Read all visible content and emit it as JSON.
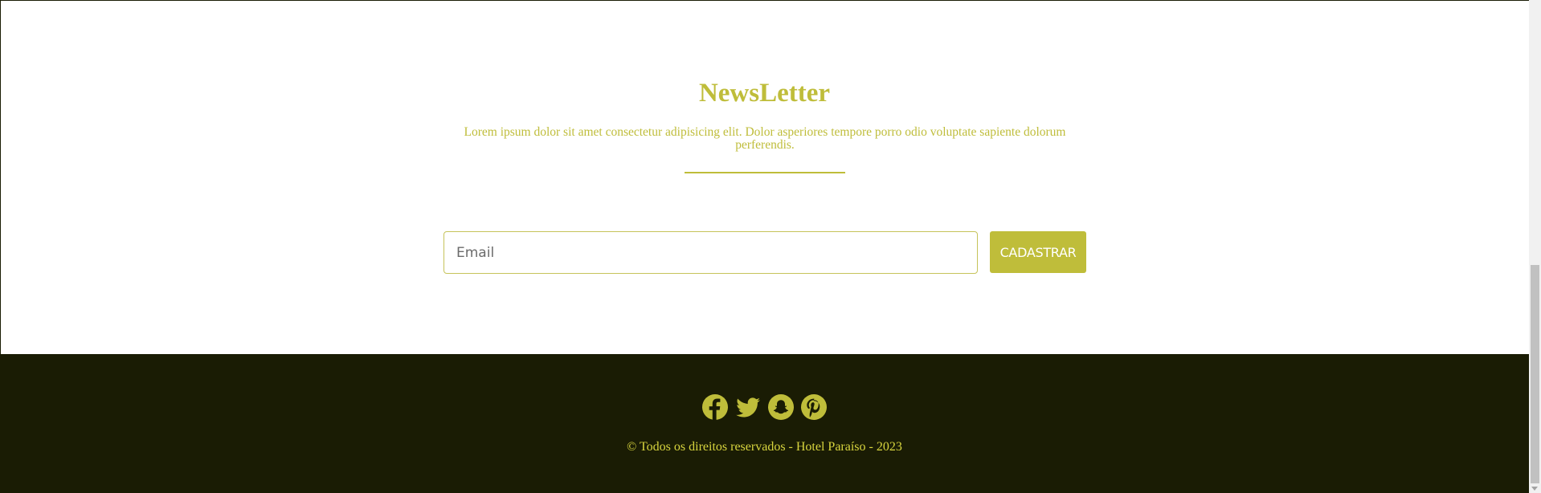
{
  "newsletter": {
    "title": "NewsLetter",
    "description": "Lorem ipsum dolor sit amet consectetur adipisicing elit. Dolor asperiores tempore porro odio voluptate sapiente dolorum perferendis.",
    "email_placeholder": "Email",
    "email_value": "",
    "submit_label": "CADASTRAR"
  },
  "footer": {
    "social_icons": [
      "facebook-icon",
      "twitter-icon",
      "snapchat-icon",
      "pinterest-icon"
    ],
    "copyright": "© Todos os direitos reservados - Hotel Paraíso - 2023"
  },
  "colors": {
    "accent": "#bfbd3a",
    "footer_bg": "#1a1c04",
    "copyright_text": "#d8d53e",
    "background": "#ffffff"
  }
}
